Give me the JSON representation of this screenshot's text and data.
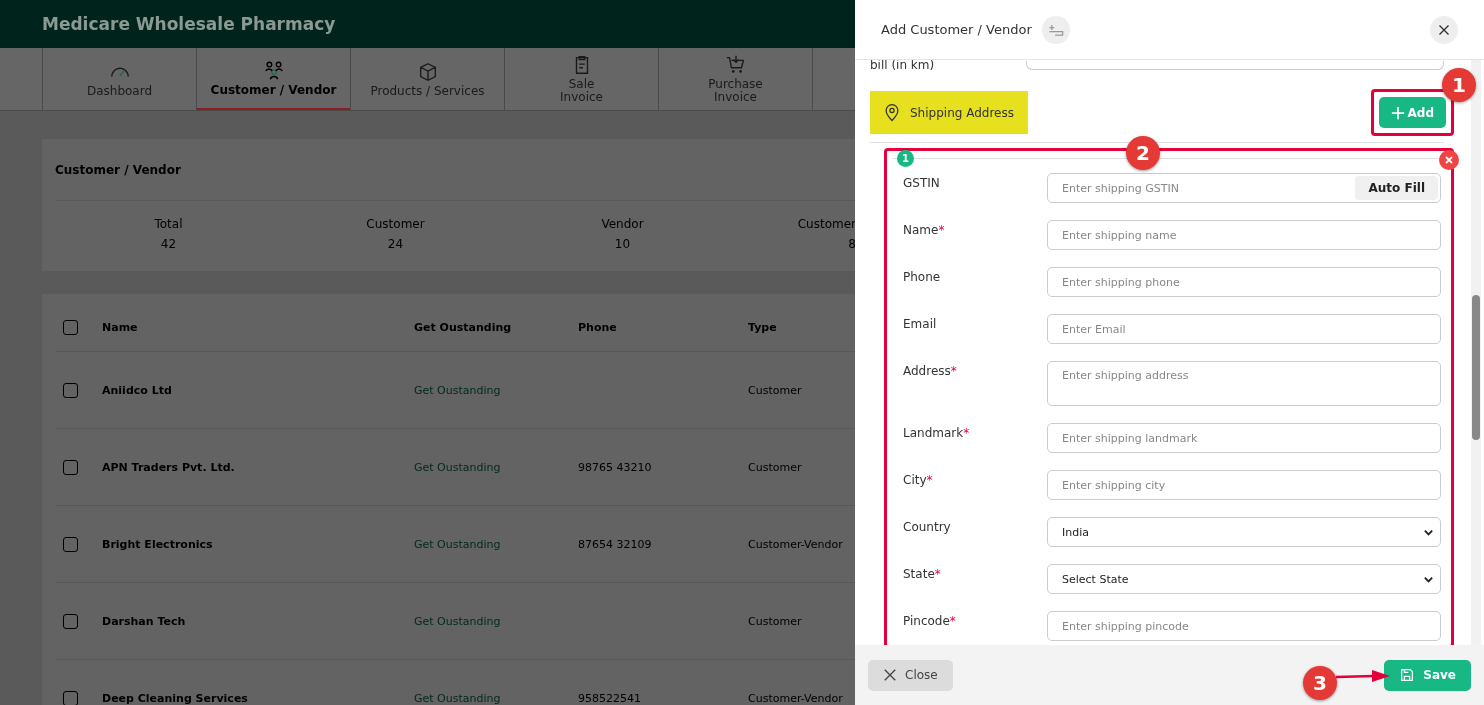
{
  "app": {
    "title": "Medicare Wholesale Pharmacy"
  },
  "nav_tabs": [
    {
      "label": "Dashboard",
      "selected": false
    },
    {
      "label": "Customer / Vendor",
      "selected": true
    },
    {
      "label": "Products / Services",
      "selected": false
    },
    {
      "label": "Sale\nInvoice",
      "selected": false
    },
    {
      "label": "Purchase\nInvoice",
      "selected": false
    }
  ],
  "summary": {
    "title": "Customer / Vendor",
    "stats": [
      {
        "label": "Total",
        "value": "42"
      },
      {
        "label": "Customer",
        "value": "24"
      },
      {
        "label": "Vendor",
        "value": "10"
      },
      {
        "label": "Customer",
        "value": "8"
      }
    ]
  },
  "table": {
    "header_checked": false,
    "columns": [
      "Name",
      "Get Oustanding",
      "Phone",
      "Type"
    ],
    "rows": [
      {
        "checked": false,
        "name": "Aniidco Ltd",
        "outstanding": "Get Oustanding",
        "phone": "",
        "type": "Customer"
      },
      {
        "checked": false,
        "name": "APN Traders Pvt. Ltd.",
        "outstanding": "Get Oustanding",
        "phone": "98765 43210",
        "type": "Customer"
      },
      {
        "checked": false,
        "name": "Bright Electronics",
        "outstanding": "Get Oustanding",
        "phone": "87654 32109",
        "type": "Customer-Vendor"
      },
      {
        "checked": false,
        "name": "Darshan Tech",
        "outstanding": "Get Oustanding",
        "phone": "",
        "type": "Customer"
      },
      {
        "checked": false,
        "name": "Deep Cleaning Services",
        "outstanding": "Get Oustanding",
        "phone": "958522541",
        "type": "Customer-Vendor"
      }
    ]
  },
  "drawer": {
    "title": "Add Customer / Vendor",
    "partial_label": "bill (in km)",
    "shipping_label": "Shipping Address",
    "add_button": "Add",
    "entry_number": "1",
    "fields": [
      {
        "kind": "autofill",
        "label": "GSTIN",
        "placeholder": "Enter shipping GSTIN",
        "button": "Auto Fill"
      },
      {
        "kind": "input",
        "label": "Name",
        "required_mark": "*",
        "placeholder": "Enter shipping name"
      },
      {
        "kind": "input",
        "label": "Phone",
        "placeholder": "Enter shipping phone"
      },
      {
        "kind": "input",
        "label": "Email",
        "placeholder": "Enter Email"
      },
      {
        "kind": "textarea",
        "label": "Address",
        "required_mark": "*",
        "placeholder": "Enter shipping address"
      },
      {
        "kind": "input",
        "label": "Landmark",
        "required_mark": "*",
        "placeholder": "Enter shipping landmark"
      },
      {
        "kind": "input",
        "label": "City",
        "required_mark": "*",
        "placeholder": "Enter shipping city"
      },
      {
        "kind": "select",
        "label": "Country",
        "value": "India"
      },
      {
        "kind": "select",
        "label": "State",
        "required_mark": "*",
        "value": "Select State"
      },
      {
        "kind": "input",
        "label": "Pincode",
        "required_mark": "*",
        "placeholder": "Enter shipping pincode"
      }
    ],
    "close_button": "Close",
    "save_button": "Save"
  },
  "annotations": [
    "1",
    "2",
    "3"
  ]
}
